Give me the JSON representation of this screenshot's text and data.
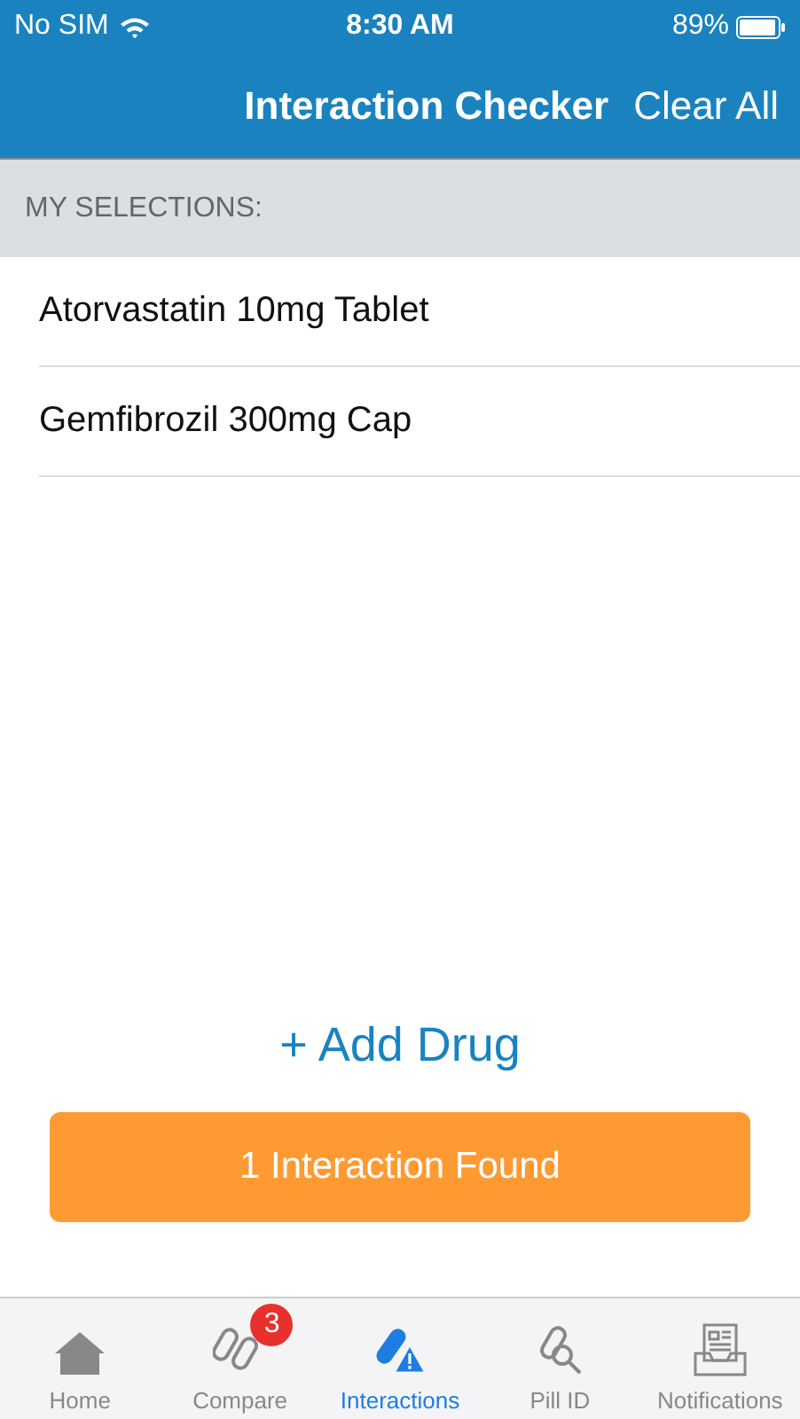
{
  "status_bar": {
    "carrier": "No SIM",
    "time": "8:30 AM",
    "battery": "89%"
  },
  "nav": {
    "title": "Interaction Checker",
    "action": "Clear All"
  },
  "section_header": "MY SELECTIONS:",
  "selections": [
    "Atorvastatin 10mg Tablet",
    "Gemfibrozil 300mg Cap"
  ],
  "add_link": "+ Add Drug",
  "result_button": "1 Interaction Found",
  "tabs": [
    {
      "kind": "home",
      "label": "Home",
      "selected": false
    },
    {
      "kind": "compare",
      "label": "Compare",
      "selected": false,
      "badge": "3"
    },
    {
      "kind": "interactions",
      "label": "Interactions",
      "selected": true
    },
    {
      "kind": "pill",
      "label": "Pill ID",
      "selected": false
    },
    {
      "kind": "notifications",
      "label": "Notifications",
      "selected": false
    }
  ]
}
